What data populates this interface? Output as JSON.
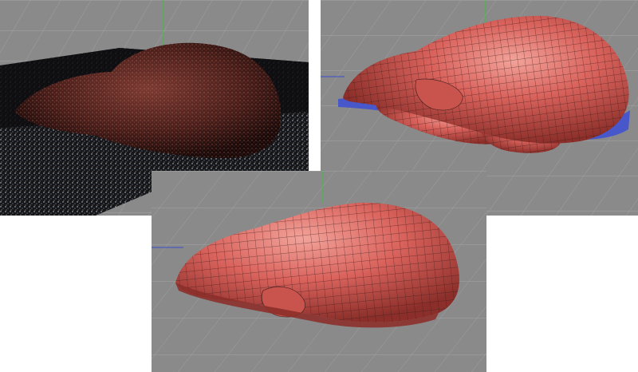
{
  "figure": {
    "panels": [
      {
        "id": "pointcloud",
        "subject": "liver-point-cloud-scan"
      },
      {
        "id": "mesh-top",
        "subject": "liver-quad-mesh-with-blue-underside"
      },
      {
        "id": "mesh-bottom",
        "subject": "liver-quad-mesh"
      }
    ]
  },
  "colors": {
    "viewport_bg": "#8a8a8a",
    "grid_line": "#a3a3a3",
    "organ_base": "#d9625c",
    "organ_highlight": "#f2a39a",
    "organ_shadow": "#8c2f2a",
    "wire": "#3a1a18",
    "underside_blue": "#4857c9",
    "cloud_dark": "#0f0f10",
    "axis_green": "#3fbf3f",
    "axis_blue": "#3a4fd0"
  }
}
